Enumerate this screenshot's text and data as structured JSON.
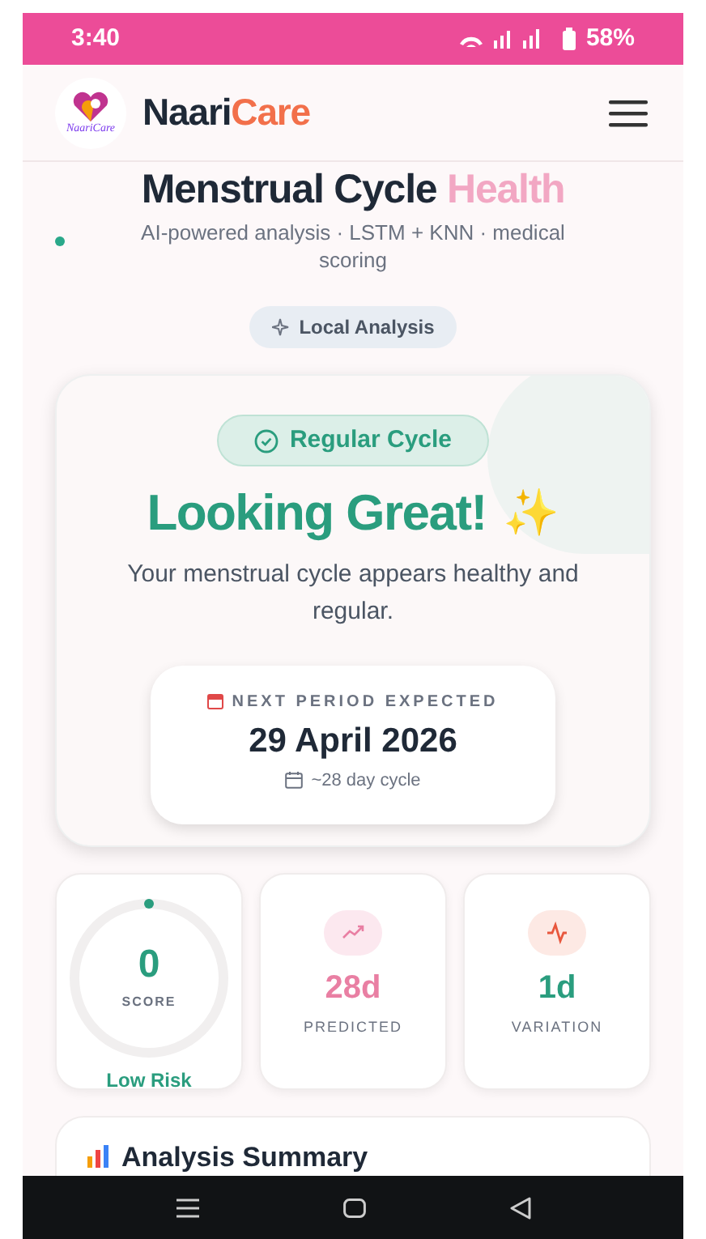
{
  "status_bar": {
    "time": "3:40",
    "battery": "58%"
  },
  "header": {
    "brand_first": "Naari",
    "brand_second": "Care",
    "logo_text": "NaariCare"
  },
  "hero": {
    "title_first": "Menstrual Cycle",
    "title_second": "Health",
    "subtitle": "AI-powered analysis · LSTM + KNN · medical scoring",
    "badge": "Local Analysis"
  },
  "result": {
    "status": "Regular Cycle",
    "headline": "Looking Great!",
    "headline_emoji": "✨",
    "message": "Your menstrual cycle appears healthy and regular.",
    "next_period": {
      "label": "NEXT PERIOD EXPECTED",
      "date": "29 April 2026",
      "cycle": "~28 day cycle"
    }
  },
  "stats": [
    {
      "kind": "score",
      "value": "0",
      "label": "SCORE",
      "risk": "Low Risk"
    },
    {
      "kind": "trend",
      "value": "28d",
      "label": "PREDICTED"
    },
    {
      "kind": "pulse",
      "value": "1d",
      "label": "VARIATION"
    }
  ],
  "summary": {
    "title": "Analysis Summary"
  }
}
